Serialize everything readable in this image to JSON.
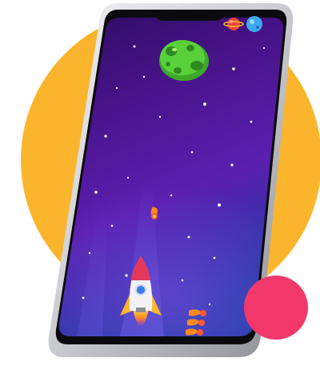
{
  "scene": {
    "type": "mobile-game-promo",
    "device": "smartphone",
    "background_circle_color": "#FBB52D",
    "accent_circle_color": "#F2386A"
  },
  "game": {
    "background_gradient": [
      "#2A0E6E",
      "#5B1A9A",
      "#7A2FC8",
      "#1E3FA8"
    ],
    "player": "rocket",
    "enemies": [
      "alien-asteroid",
      "fireball"
    ],
    "lives_icons": [
      "red-planet-icon",
      "blue-planet-icon"
    ],
    "fireball_count_bottom": 3
  },
  "colors": {
    "phone_frame": "#2B2B2E",
    "phone_bezel": "#0B0B0D",
    "asteroid_green": "#59D13B",
    "rocket_flame": "#FF8A1E",
    "star": "#FFFFFF"
  }
}
